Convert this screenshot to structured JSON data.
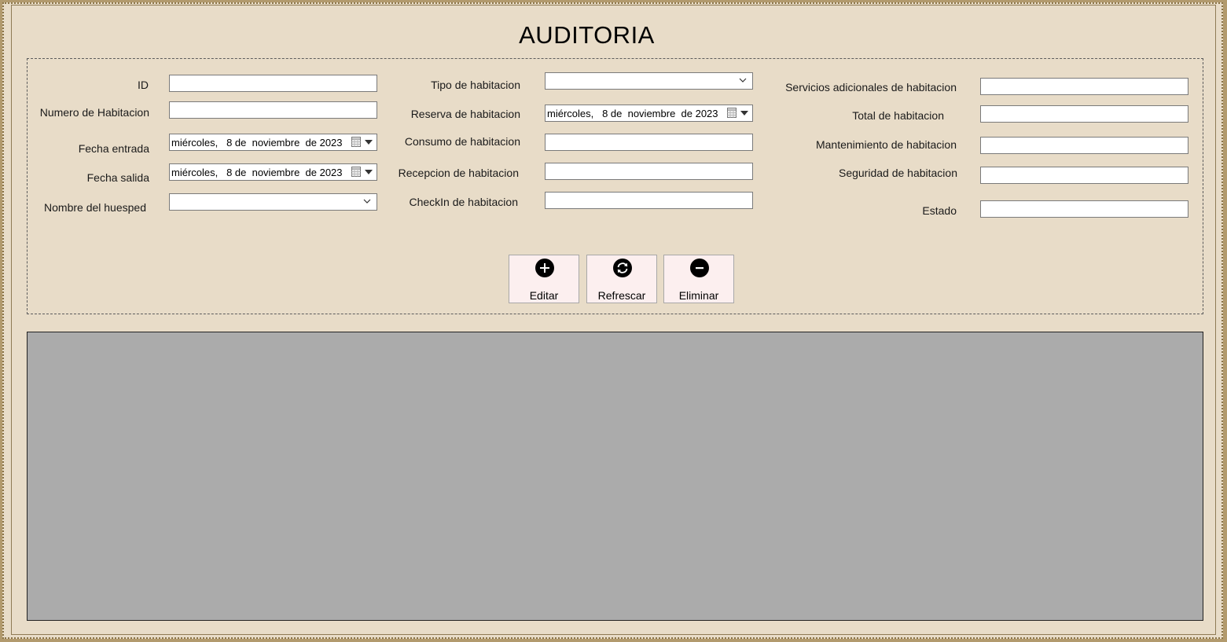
{
  "title": "AUDITORIA",
  "fields": {
    "id": {
      "label": "ID",
      "value": ""
    },
    "numero_habitacion": {
      "label": "Numero de Habitacion",
      "value": ""
    },
    "fecha_entrada": {
      "label": "Fecha entrada",
      "value": "miércoles,   8 de  noviembre  de 2023"
    },
    "fecha_salida": {
      "label": "Fecha salida",
      "value": "miércoles,   8 de  noviembre  de 2023"
    },
    "nombre_huesped": {
      "label": "Nombre del huesped",
      "value": ""
    },
    "tipo_habitacion": {
      "label": "Tipo de habitacion",
      "value": ""
    },
    "reserva_habitacion": {
      "label": "Reserva de habitacion",
      "value": "miércoles,   8 de  noviembre  de 2023"
    },
    "consumo_habitacion": {
      "label": "Consumo de habitacion",
      "value": ""
    },
    "recepcion_habitacion": {
      "label": "Recepcion de habitacion",
      "value": ""
    },
    "checkin_habitacion": {
      "label": "CheckIn de habitacion",
      "value": ""
    },
    "servicios_adicionales": {
      "label": "Servicios adicionales de habitacion",
      "value": ""
    },
    "total_habitacion": {
      "label": "Total de habitacion",
      "value": ""
    },
    "mantenimiento_habitacion": {
      "label": "Mantenimiento de habitacion",
      "value": ""
    },
    "seguridad_habitacion": {
      "label": "Seguridad de habitacion",
      "value": ""
    },
    "estado": {
      "label": "Estado",
      "value": ""
    }
  },
  "buttons": {
    "editar": {
      "label": "Editar",
      "icon": "plus-circle-icon"
    },
    "refrescar": {
      "label": "Refrescar",
      "icon": "refresh-circle-icon"
    },
    "eliminar": {
      "label": "Eliminar",
      "icon": "minus-circle-icon"
    }
  },
  "colors": {
    "window_bg": "#e8dcc8",
    "outer_border": "#b29a6d",
    "button_bg": "#fcefef",
    "grid_bg": "#ababab"
  }
}
